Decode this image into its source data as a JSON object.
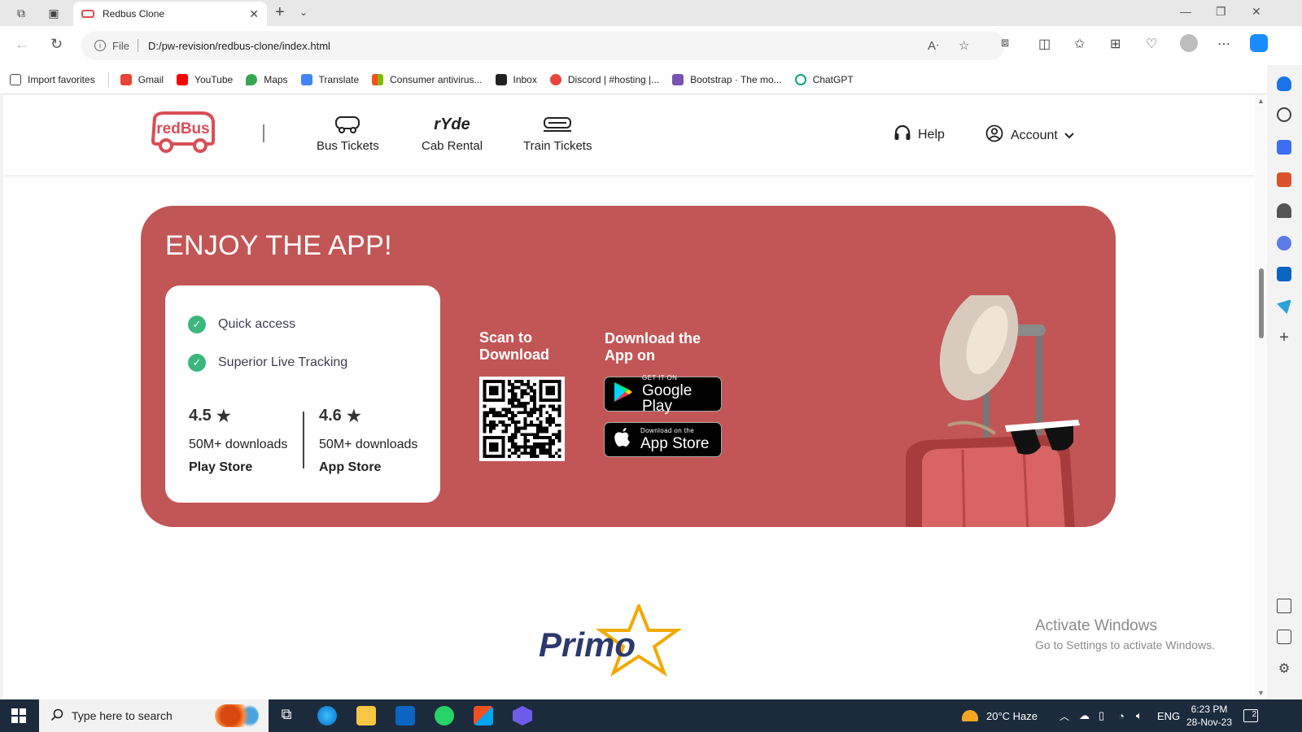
{
  "browser": {
    "tab_title": "Redbus Clone",
    "address_prefix": "File",
    "address": "D:/pw-revision/redbus-clone/index.html",
    "bookmarks": [
      {
        "label": "Import favorites",
        "color": "#444444"
      },
      {
        "label": "Gmail",
        "color": "#ea4335"
      },
      {
        "label": "YouTube",
        "color": "#ff0000"
      },
      {
        "label": "Maps",
        "color": "#34a853"
      },
      {
        "label": "Translate",
        "color": "#4285f4"
      },
      {
        "label": "Consumer antivirus...",
        "color": "#f25022"
      },
      {
        "label": "Inbox",
        "color": "#222222"
      },
      {
        "label": "Discord | #hosting |...",
        "color": "#e8453c"
      },
      {
        "label": "Bootstrap · The mo...",
        "color": "#7952b3"
      },
      {
        "label": "ChatGPT",
        "color": "#10a37f"
      }
    ]
  },
  "header": {
    "logo_text": "redBus",
    "nav": [
      {
        "label": "Bus Tickets",
        "icon": "bus-icon"
      },
      {
        "label": "Cab Rental",
        "icon": "ryde-icon"
      },
      {
        "label": "Train Tickets",
        "icon": "train-icon"
      }
    ],
    "help_label": "Help",
    "account_label": "Account"
  },
  "banner": {
    "title": "ENJOY THE APP!",
    "features": [
      "Quick access",
      "Superior Live Tracking"
    ],
    "ratings": [
      {
        "score": "4.5",
        "downloads": "50M+ downloads",
        "store": "Play Store"
      },
      {
        "score": "4.6",
        "downloads": "50M+ downloads",
        "store": "App Store"
      }
    ],
    "scan_line1": "Scan to",
    "scan_line2": "Download",
    "download_line1": "Download the",
    "download_line2": "App on",
    "google_play_small": "GET IT ON",
    "google_play_big": "Google Play",
    "app_store_small": "Download on the",
    "app_store_big": "App Store",
    "accent_color": "#c25656"
  },
  "below": {
    "partner_logo_text": "Primo"
  },
  "watermark": {
    "line1": "Activate Windows",
    "line2": "Go to Settings to activate Windows."
  },
  "taskbar": {
    "search_placeholder": "Type here to search",
    "weather": "20°C Haze",
    "language": "ENG",
    "time": "6:23 PM",
    "date": "28-Nov-23",
    "notification_count": "2"
  }
}
